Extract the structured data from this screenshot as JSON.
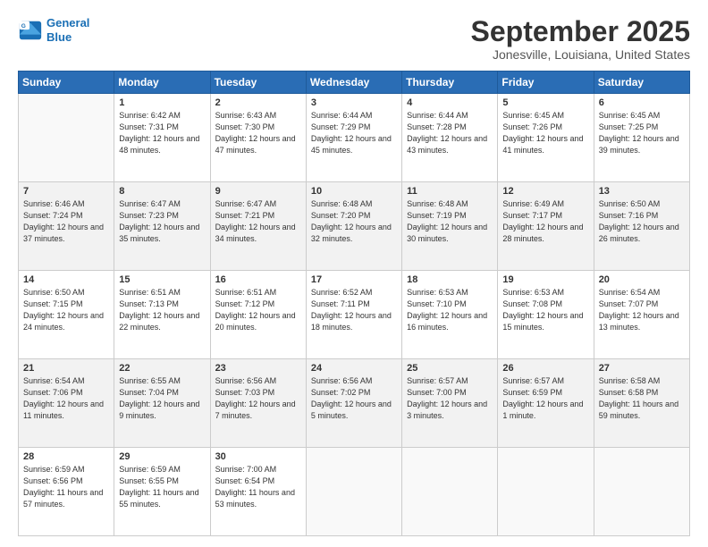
{
  "header": {
    "logo_line1": "General",
    "logo_line2": "Blue",
    "month_title": "September 2025",
    "location": "Jonesville, Louisiana, United States"
  },
  "weekdays": [
    "Sunday",
    "Monday",
    "Tuesday",
    "Wednesday",
    "Thursday",
    "Friday",
    "Saturday"
  ],
  "weeks": [
    [
      {
        "day": "",
        "sunrise": "",
        "sunset": "",
        "daylight": ""
      },
      {
        "day": "1",
        "sunrise": "Sunrise: 6:42 AM",
        "sunset": "Sunset: 7:31 PM",
        "daylight": "Daylight: 12 hours and 48 minutes."
      },
      {
        "day": "2",
        "sunrise": "Sunrise: 6:43 AM",
        "sunset": "Sunset: 7:30 PM",
        "daylight": "Daylight: 12 hours and 47 minutes."
      },
      {
        "day": "3",
        "sunrise": "Sunrise: 6:44 AM",
        "sunset": "Sunset: 7:29 PM",
        "daylight": "Daylight: 12 hours and 45 minutes."
      },
      {
        "day": "4",
        "sunrise": "Sunrise: 6:44 AM",
        "sunset": "Sunset: 7:28 PM",
        "daylight": "Daylight: 12 hours and 43 minutes."
      },
      {
        "day": "5",
        "sunrise": "Sunrise: 6:45 AM",
        "sunset": "Sunset: 7:26 PM",
        "daylight": "Daylight: 12 hours and 41 minutes."
      },
      {
        "day": "6",
        "sunrise": "Sunrise: 6:45 AM",
        "sunset": "Sunset: 7:25 PM",
        "daylight": "Daylight: 12 hours and 39 minutes."
      }
    ],
    [
      {
        "day": "7",
        "sunrise": "Sunrise: 6:46 AM",
        "sunset": "Sunset: 7:24 PM",
        "daylight": "Daylight: 12 hours and 37 minutes."
      },
      {
        "day": "8",
        "sunrise": "Sunrise: 6:47 AM",
        "sunset": "Sunset: 7:23 PM",
        "daylight": "Daylight: 12 hours and 35 minutes."
      },
      {
        "day": "9",
        "sunrise": "Sunrise: 6:47 AM",
        "sunset": "Sunset: 7:21 PM",
        "daylight": "Daylight: 12 hours and 34 minutes."
      },
      {
        "day": "10",
        "sunrise": "Sunrise: 6:48 AM",
        "sunset": "Sunset: 7:20 PM",
        "daylight": "Daylight: 12 hours and 32 minutes."
      },
      {
        "day": "11",
        "sunrise": "Sunrise: 6:48 AM",
        "sunset": "Sunset: 7:19 PM",
        "daylight": "Daylight: 12 hours and 30 minutes."
      },
      {
        "day": "12",
        "sunrise": "Sunrise: 6:49 AM",
        "sunset": "Sunset: 7:17 PM",
        "daylight": "Daylight: 12 hours and 28 minutes."
      },
      {
        "day": "13",
        "sunrise": "Sunrise: 6:50 AM",
        "sunset": "Sunset: 7:16 PM",
        "daylight": "Daylight: 12 hours and 26 minutes."
      }
    ],
    [
      {
        "day": "14",
        "sunrise": "Sunrise: 6:50 AM",
        "sunset": "Sunset: 7:15 PM",
        "daylight": "Daylight: 12 hours and 24 minutes."
      },
      {
        "day": "15",
        "sunrise": "Sunrise: 6:51 AM",
        "sunset": "Sunset: 7:13 PM",
        "daylight": "Daylight: 12 hours and 22 minutes."
      },
      {
        "day": "16",
        "sunrise": "Sunrise: 6:51 AM",
        "sunset": "Sunset: 7:12 PM",
        "daylight": "Daylight: 12 hours and 20 minutes."
      },
      {
        "day": "17",
        "sunrise": "Sunrise: 6:52 AM",
        "sunset": "Sunset: 7:11 PM",
        "daylight": "Daylight: 12 hours and 18 minutes."
      },
      {
        "day": "18",
        "sunrise": "Sunrise: 6:53 AM",
        "sunset": "Sunset: 7:10 PM",
        "daylight": "Daylight: 12 hours and 16 minutes."
      },
      {
        "day": "19",
        "sunrise": "Sunrise: 6:53 AM",
        "sunset": "Sunset: 7:08 PM",
        "daylight": "Daylight: 12 hours and 15 minutes."
      },
      {
        "day": "20",
        "sunrise": "Sunrise: 6:54 AM",
        "sunset": "Sunset: 7:07 PM",
        "daylight": "Daylight: 12 hours and 13 minutes."
      }
    ],
    [
      {
        "day": "21",
        "sunrise": "Sunrise: 6:54 AM",
        "sunset": "Sunset: 7:06 PM",
        "daylight": "Daylight: 12 hours and 11 minutes."
      },
      {
        "day": "22",
        "sunrise": "Sunrise: 6:55 AM",
        "sunset": "Sunset: 7:04 PM",
        "daylight": "Daylight: 12 hours and 9 minutes."
      },
      {
        "day": "23",
        "sunrise": "Sunrise: 6:56 AM",
        "sunset": "Sunset: 7:03 PM",
        "daylight": "Daylight: 12 hours and 7 minutes."
      },
      {
        "day": "24",
        "sunrise": "Sunrise: 6:56 AM",
        "sunset": "Sunset: 7:02 PM",
        "daylight": "Daylight: 12 hours and 5 minutes."
      },
      {
        "day": "25",
        "sunrise": "Sunrise: 6:57 AM",
        "sunset": "Sunset: 7:00 PM",
        "daylight": "Daylight: 12 hours and 3 minutes."
      },
      {
        "day": "26",
        "sunrise": "Sunrise: 6:57 AM",
        "sunset": "Sunset: 6:59 PM",
        "daylight": "Daylight: 12 hours and 1 minute."
      },
      {
        "day": "27",
        "sunrise": "Sunrise: 6:58 AM",
        "sunset": "Sunset: 6:58 PM",
        "daylight": "Daylight: 11 hours and 59 minutes."
      }
    ],
    [
      {
        "day": "28",
        "sunrise": "Sunrise: 6:59 AM",
        "sunset": "Sunset: 6:56 PM",
        "daylight": "Daylight: 11 hours and 57 minutes."
      },
      {
        "day": "29",
        "sunrise": "Sunrise: 6:59 AM",
        "sunset": "Sunset: 6:55 PM",
        "daylight": "Daylight: 11 hours and 55 minutes."
      },
      {
        "day": "30",
        "sunrise": "Sunrise: 7:00 AM",
        "sunset": "Sunset: 6:54 PM",
        "daylight": "Daylight: 11 hours and 53 minutes."
      },
      {
        "day": "",
        "sunrise": "",
        "sunset": "",
        "daylight": ""
      },
      {
        "day": "",
        "sunrise": "",
        "sunset": "",
        "daylight": ""
      },
      {
        "day": "",
        "sunrise": "",
        "sunset": "",
        "daylight": ""
      },
      {
        "day": "",
        "sunrise": "",
        "sunset": "",
        "daylight": ""
      }
    ]
  ]
}
